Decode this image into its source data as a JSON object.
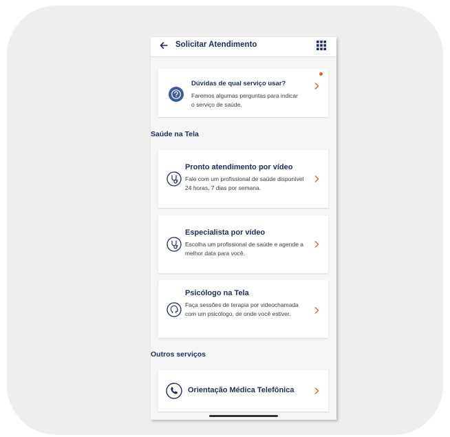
{
  "header": {
    "title": "Solicitar Atendimento"
  },
  "help_card": {
    "title": "Dúvidas de qual serviço usar?",
    "description": "Faremos algumas perguntas para indicar o serviço de saúde."
  },
  "sections": {
    "saude_na_tela": "Saúde na Tela",
    "outros_servicos": "Outros serviços"
  },
  "services": [
    {
      "title": "Pronto atendimento por vídeo",
      "description": "Fale com um profissional de saúde disponível 24 horas, 7 dias por semana."
    },
    {
      "title": "Especialista por vídeo",
      "description": "Escolha um profissional de saúde e agende a melhor data para você."
    },
    {
      "title": "Psicólogo na Tela",
      "description": "Faça sessões de terapia por videochamada com um psicólogo, de onde você estiver."
    }
  ],
  "other_services": [
    {
      "title": "Orientação Médica Telefônica"
    }
  ],
  "colors": {
    "navy": "#1f2d55",
    "accent_orange": "#e8612c",
    "icon_blue": "#3d5a99",
    "background": "#f5f5f5"
  },
  "icons": {
    "back": "arrow-left-icon",
    "apps": "grid-icon",
    "help": "question-icon",
    "stethoscope": "stethoscope-icon",
    "psychology": "head-icon",
    "phone": "phone-icon",
    "chevron": "chevron-right-icon"
  }
}
